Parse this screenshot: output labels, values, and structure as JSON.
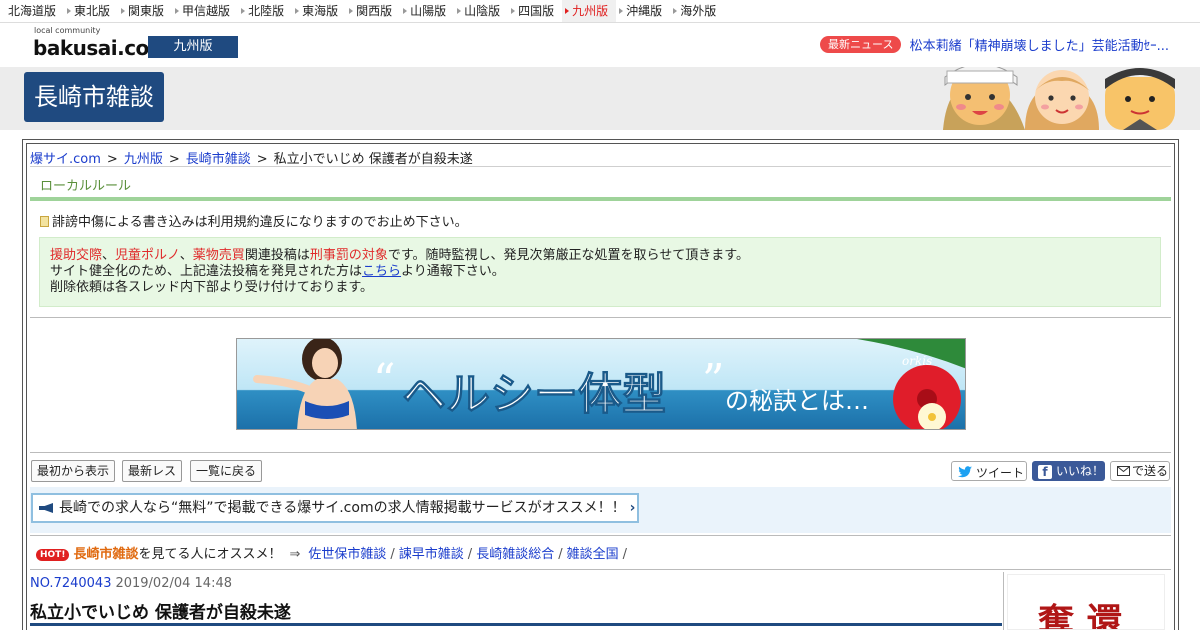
{
  "region_nav": {
    "items": [
      "北海道版",
      "東北版",
      "関東版",
      "甲信越版",
      "北陸版",
      "東海版",
      "関西版",
      "山陽版",
      "山陰版",
      "四国版",
      "九州版",
      "沖縄版",
      "海外版"
    ],
    "active_index": 10
  },
  "header": {
    "logo_small": "local community",
    "logo_main": "bakusai.com",
    "edition": "九州版",
    "news_badge": "最新ニュース",
    "news_text": "松本莉緒「精神崩壊しました」芸能活動ｾｰ..."
  },
  "board": {
    "title": "長崎市雑談"
  },
  "breadcrumb": {
    "items": [
      "爆サイ.com",
      "九州版",
      "長崎市雑談"
    ],
    "current": "私立小でいじめ 保護者が自殺未遂",
    "separator": ">"
  },
  "local_rule": {
    "heading": "ローカルルール",
    "notice": "誹謗中傷による書き込みは利用規約違反になりますのでお止め下さい。",
    "warning": {
      "terms": [
        "援助交際",
        "児童ポルノ",
        "薬物売買"
      ],
      "term_sep": "、",
      "mid": "関連投稿は",
      "penalty": "刑事罰の対象",
      "rest1": "です。随時監視し、発見次第厳正な処置を取らせて頂きます。",
      "line2_pre": "サイト健全化のため、上記違法投稿を発見された方は",
      "line2_link": "こちら",
      "line2_post": "より通報下さい。",
      "line3": "削除依頼は各スレッド内下部より受け付けております。"
    }
  },
  "banner": {
    "quote_open": "“",
    "main_text": "ヘルシー体型",
    "quote_close": "”",
    "suffix": "の秘訣とは…",
    "brand": "orkis"
  },
  "toolbar": {
    "first_label": "最初から表示",
    "latest_label": "最新レス",
    "list_label": "一覧に戻る"
  },
  "share": {
    "tweet": "ツイート",
    "like": "いいね！",
    "mail": "で送る"
  },
  "job_ad": {
    "text": "長崎での求人なら“無料”で掲載できる爆サイ.comの求人情報掲載サービスがオススメ！！"
  },
  "recommend": {
    "hot": "HOT!",
    "board": "長崎市雑談",
    "text": "を見てる人にオススメ！",
    "arrow": "⇒",
    "links": [
      "佐世保市雑談",
      "諫早市雑談",
      "長崎雑談総合",
      "雑談全国"
    ],
    "sep": "/"
  },
  "post": {
    "number": "NO.7240043",
    "date": "2019/02/04 14:48",
    "title": "私立小でいじめ 保護者が自殺未遂"
  },
  "side_ad": {
    "text": "奪 還"
  },
  "colors": {
    "brand_navy": "#1f4a80",
    "link": "#1a3ccc",
    "alert_red": "#e02b2b",
    "rule_green": "#9fd39a",
    "warning_bg": "#e8f8e4"
  }
}
